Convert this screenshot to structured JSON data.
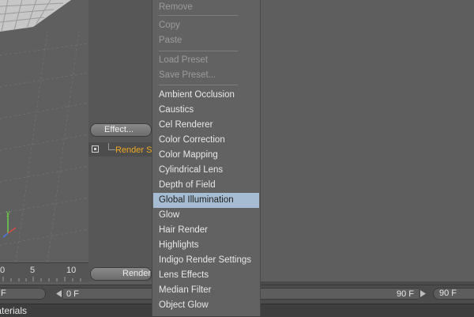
{
  "panel": {
    "effect_button": "Effect...",
    "tree_item": "Render Settings",
    "render_button": "Render Settings..."
  },
  "timeline": {
    "ticks": [
      "0",
      "5",
      "10"
    ],
    "start_frame": "F",
    "current_frame": "0 F",
    "end_frame": "90 F",
    "max_frame": "90 F"
  },
  "status": {
    "text": "Materials"
  },
  "menu": {
    "items": [
      {
        "label": "Remove",
        "state": "disabled"
      },
      {
        "label": "Copy",
        "state": "disabled"
      },
      {
        "label": "Paste",
        "state": "disabled"
      },
      {
        "label": "Load Preset",
        "state": "disabled"
      },
      {
        "label": "Save Preset...",
        "state": "disabled"
      },
      {
        "label": "Ambient Occlusion",
        "state": "enabled"
      },
      {
        "label": "Caustics",
        "state": "enabled"
      },
      {
        "label": "Cel Renderer",
        "state": "enabled"
      },
      {
        "label": "Color Correction",
        "state": "enabled"
      },
      {
        "label": "Color Mapping",
        "state": "enabled"
      },
      {
        "label": "Cylindrical Lens",
        "state": "enabled"
      },
      {
        "label": "Depth of Field",
        "state": "enabled"
      },
      {
        "label": "Global Illumination",
        "state": "selected"
      },
      {
        "label": "Glow",
        "state": "enabled"
      },
      {
        "label": "Hair Render",
        "state": "enabled"
      },
      {
        "label": "Highlights",
        "state": "enabled"
      },
      {
        "label": "Indigo Render Settings",
        "state": "enabled"
      },
      {
        "label": "Lens Effects",
        "state": "enabled"
      },
      {
        "label": "Median Filter",
        "state": "enabled"
      },
      {
        "label": "Object Glow",
        "state": "enabled"
      }
    ]
  },
  "colors": {
    "selection": "#a6bcd2",
    "tree_label": "#f0a81e",
    "axis_y": "#6bd04a",
    "axis_x": "#d84a3a",
    "axis_z": "#4a78e0"
  }
}
